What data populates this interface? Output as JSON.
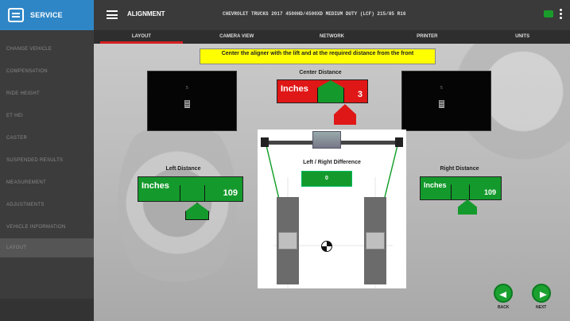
{
  "sidebar": {
    "service_label": "SERVICE",
    "items": [
      {
        "label": "CHANGE VEHICLE"
      },
      {
        "label": "COMPENSATION"
      },
      {
        "label": "RIDE HEIGHT"
      },
      {
        "label": "ET HEI"
      },
      {
        "label": "CASTER"
      },
      {
        "label": "SUSPENDED RESULTS"
      },
      {
        "label": "MEASUREMENT"
      },
      {
        "label": "ADJUSTMENTS"
      },
      {
        "label": "VEHICLE INFORMATION"
      },
      {
        "label": "LAYOUT"
      }
    ]
  },
  "header": {
    "title": "ALIGNMENT",
    "vehicle": "CHEVROLET TRUCKS 2017 4500HD/4500XD MEDIUM DUTY (LCF) 215/85 R16"
  },
  "tabs": [
    {
      "label": "LAYOUT",
      "active": true
    },
    {
      "label": "CAMERA VIEW",
      "active": false
    },
    {
      "label": "NETWORK",
      "active": false
    },
    {
      "label": "PRINTER",
      "active": false
    },
    {
      "label": "UNITS",
      "active": false
    }
  ],
  "main": {
    "instruction": "Center the aligner with the lift and at the required distance from the front",
    "center_distance": {
      "title": "Center Distance",
      "unit": "Inches",
      "value": "3",
      "color": "#e01717"
    },
    "left_distance": {
      "title": "Left Distance",
      "unit": "Inches",
      "value": "109",
      "color": "#149a2c"
    },
    "right_distance": {
      "title": "Right Distance",
      "unit": "Inches",
      "value": "109",
      "color": "#149a2c"
    },
    "lr_difference": {
      "title": "Left / Right Difference",
      "value": "0"
    }
  },
  "nav": {
    "back": "BACK",
    "next": "NEXT"
  },
  "colors": {
    "accent": "#2f86c6",
    "ok": "#149a2c",
    "warn": "#e01717",
    "instruction_bg": "#ffff00"
  }
}
